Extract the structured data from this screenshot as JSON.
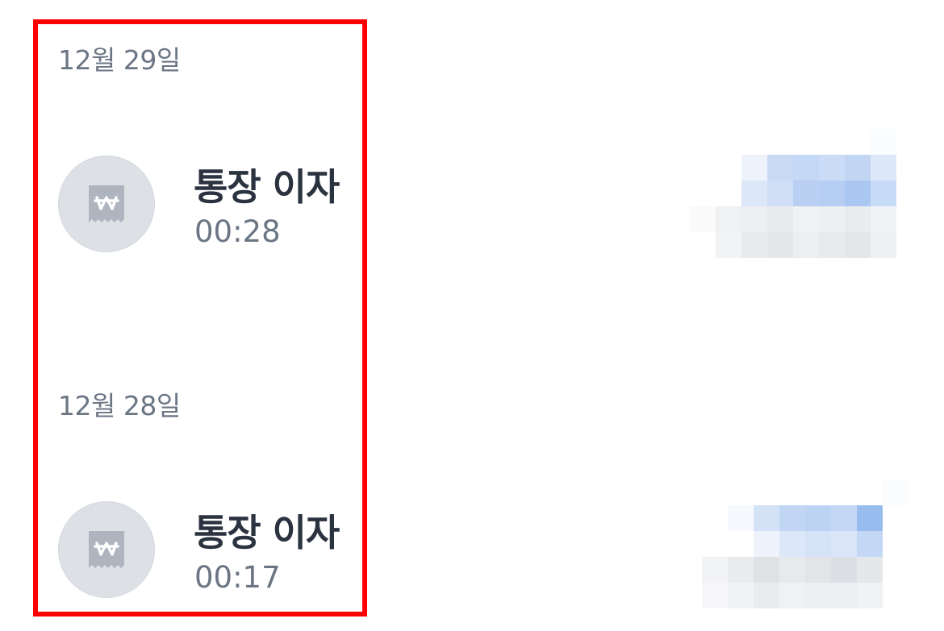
{
  "transactions": [
    {
      "date": "12월 29일",
      "title": "통장 이자",
      "time": "00:28",
      "icon": "receipt-won-icon"
    },
    {
      "date": "12월 28일",
      "title": "통장 이자",
      "time": "00:17",
      "icon": "receipt-won-icon"
    }
  ],
  "colors": {
    "highlight": "#ff0000",
    "icon_bg": "#dde1e6",
    "icon_fg": "#aeb5bf",
    "title": "#2b3340",
    "secondary": "#6b7684"
  }
}
